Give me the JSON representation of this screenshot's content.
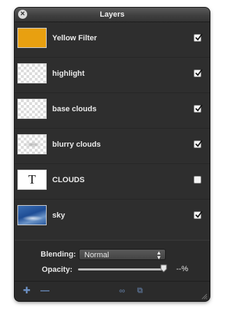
{
  "window": {
    "title": "Layers"
  },
  "layers": [
    {
      "name": "Yellow Filter",
      "visible": true,
      "thumb": "yellow-swatch",
      "color": "#e8a010"
    },
    {
      "name": "highlight",
      "visible": true,
      "thumb": "transparent"
    },
    {
      "name": "base clouds",
      "visible": true,
      "thumb": "transparent"
    },
    {
      "name": "blurry clouds",
      "visible": true,
      "thumb": "transparent-clouds"
    },
    {
      "name": "CLOUDS",
      "visible": false,
      "thumb": "text",
      "glyph": "T"
    },
    {
      "name": "sky",
      "visible": true,
      "thumb": "sky-image"
    }
  ],
  "blending": {
    "label": "Blending:",
    "value": "Normal",
    "arrows_icon": "up-down-arrows-icon"
  },
  "opacity": {
    "label": "Opacity:",
    "value_text": "--%",
    "slider_level": 0.98
  },
  "toolbar": {
    "add_icon": "plus-icon",
    "remove_icon": "minus-icon",
    "link_icon": "link-icon",
    "merge_icon": "merge-icon"
  },
  "colors": {
    "panel_bg": "#2e2e2e",
    "accent_blue": "#6b8ec0"
  }
}
